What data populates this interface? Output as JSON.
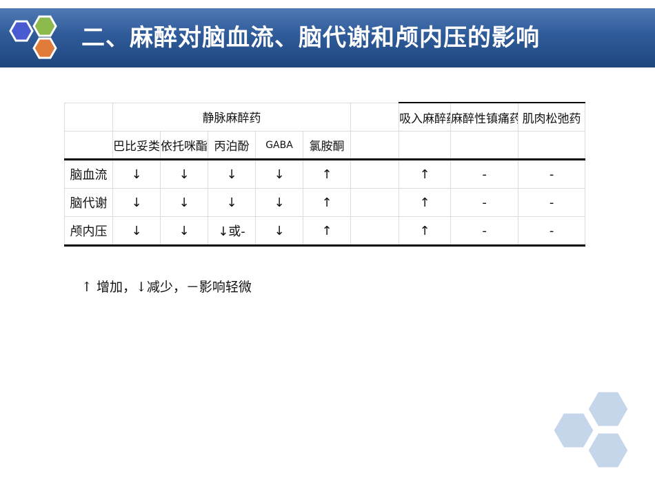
{
  "slide": {
    "title": "二、麻醉对脑血流、脑代谢和颅内压的影响"
  },
  "table": {
    "group_header": "静脉麻醉药",
    "right_headers": [
      "吸入麻醉药",
      "麻醉性镇痛药",
      "肌肉松弛药"
    ],
    "iv_subheaders": [
      "巴比妥类",
      "依托咪酯",
      "丙泊酚",
      "GABA",
      "氯胺酮"
    ],
    "rows": [
      {
        "label": "脑血流",
        "cells": [
          "↓",
          "↓",
          "↓",
          "↓",
          "↑",
          "",
          "↑",
          "-",
          "-"
        ]
      },
      {
        "label": "脑代谢",
        "cells": [
          "↓",
          "↓",
          "↓",
          "↓",
          "↑",
          "",
          "↑",
          "-",
          "-"
        ]
      },
      {
        "label": "颅内压",
        "cells": [
          "↓",
          "↓",
          "↓或-",
          "↓",
          "↑",
          "",
          "↑",
          "-",
          "-"
        ]
      }
    ]
  },
  "legend": "↑ 增加，↓减少，－影响轻微",
  "colors": {
    "header_bg": "#2f5b99",
    "hex_blue": "#4a5bd1",
    "hex_green": "#8dba4c",
    "hex_orange": "#e07b3a",
    "deco_hex": "#c5d5ea"
  }
}
